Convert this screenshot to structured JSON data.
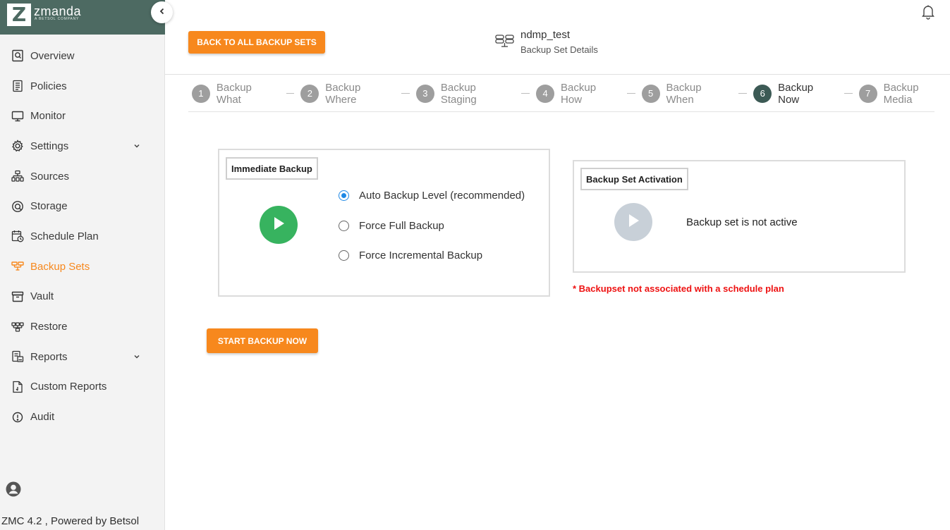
{
  "brand": {
    "mark": "Z",
    "name": "zmanda",
    "sub": "A BETSOL COMPANY"
  },
  "sidebar": {
    "items": [
      {
        "label": "Overview",
        "icon": "overview-icon"
      },
      {
        "label": "Policies",
        "icon": "policies-icon"
      },
      {
        "label": "Monitor",
        "icon": "monitor-icon"
      },
      {
        "label": "Settings",
        "icon": "gear-icon",
        "expandable": true
      },
      {
        "label": "Sources",
        "icon": "sources-icon"
      },
      {
        "label": "Storage",
        "icon": "storage-icon"
      },
      {
        "label": "Schedule Plan",
        "icon": "schedule-icon"
      },
      {
        "label": "Backup Sets",
        "icon": "backup-sets-icon",
        "active": true
      },
      {
        "label": "Vault",
        "icon": "vault-icon"
      },
      {
        "label": "Restore",
        "icon": "restore-icon"
      },
      {
        "label": "Reports",
        "icon": "reports-icon",
        "expandable": true
      },
      {
        "label": "Custom Reports",
        "icon": "custom-reports-icon"
      },
      {
        "label": "Audit",
        "icon": "audit-icon"
      }
    ],
    "version": "ZMC 4.2 , Powered by Betsol"
  },
  "header": {
    "back_label": "BACK TO ALL BACKUP SETS",
    "set_name": "ndmp_test",
    "set_subtitle": "Backup Set Details"
  },
  "steps": [
    {
      "num": "1",
      "label": "Backup What"
    },
    {
      "num": "2",
      "label": "Backup Where"
    },
    {
      "num": "3",
      "label": "Backup Staging"
    },
    {
      "num": "4",
      "label": "Backup How"
    },
    {
      "num": "5",
      "label": "Backup When"
    },
    {
      "num": "6",
      "label": "Backup Now",
      "active": true
    },
    {
      "num": "7",
      "label": "Backup Media"
    }
  ],
  "immediate": {
    "title": "Immediate Backup",
    "options": [
      {
        "label": "Auto Backup Level (recommended)",
        "checked": true
      },
      {
        "label": "Force Full Backup",
        "checked": false
      },
      {
        "label": "Force Incremental Backup",
        "checked": false
      }
    ]
  },
  "activation": {
    "title": "Backup Set Activation",
    "status": "Backup set is not active",
    "warning": "* Backupset not associated with a schedule plan"
  },
  "start_label": "START BACKUP NOW",
  "colors": {
    "accent": "#f7881d",
    "brand": "#4d6a62",
    "play": "#37b35f",
    "warning": "#ee1111",
    "radio": "#1e88e5"
  }
}
